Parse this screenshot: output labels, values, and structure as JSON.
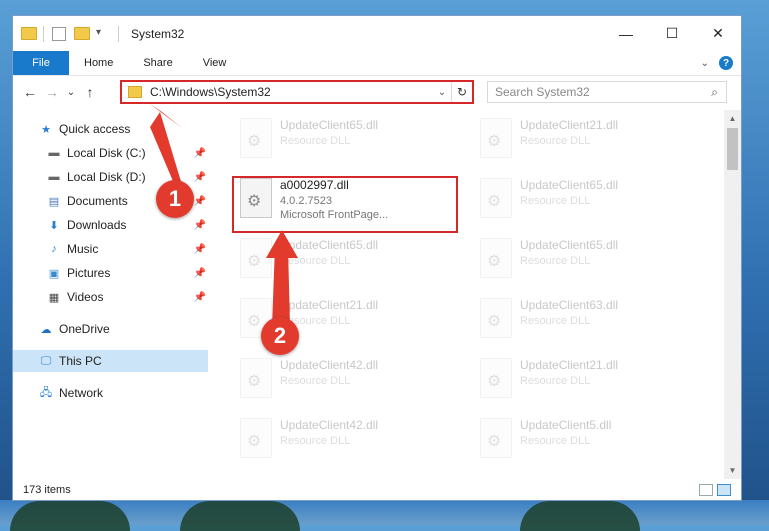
{
  "window": {
    "title": "System32",
    "controls": {
      "minimize": "—",
      "maximize": "☐",
      "close": "✕"
    }
  },
  "ribbon": {
    "file": "File",
    "tabs": [
      "Home",
      "Share",
      "View"
    ],
    "collapse": "⌄",
    "help": "?"
  },
  "address": {
    "path": "C:\\Windows\\System32",
    "search_placeholder": "Search System32"
  },
  "nav": {
    "back": "←",
    "forward": "→",
    "recent": "⌄",
    "up": "↑"
  },
  "sidebar": {
    "items": [
      {
        "label": "Quick access",
        "icon": "star-icon",
        "pinned": false
      },
      {
        "label": "Local Disk (C:)",
        "icon": "drive-icon",
        "pinned": true
      },
      {
        "label": "Local Disk (D:)",
        "icon": "drive-icon",
        "pinned": true
      },
      {
        "label": "Documents",
        "icon": "documents-icon",
        "pinned": true
      },
      {
        "label": "Downloads",
        "icon": "download-icon",
        "pinned": true
      },
      {
        "label": "Music",
        "icon": "music-icon",
        "pinned": true
      },
      {
        "label": "Pictures",
        "icon": "pictures-icon",
        "pinned": true
      },
      {
        "label": "Videos",
        "icon": "videos-icon",
        "pinned": true
      },
      {
        "label": "OneDrive",
        "icon": "cloud-icon",
        "pinned": false
      },
      {
        "label": "This PC",
        "icon": "computer-icon",
        "pinned": false,
        "selected": true
      },
      {
        "label": "Network",
        "icon": "network-icon",
        "pinned": false
      }
    ]
  },
  "files": {
    "highlighted": {
      "name": "a0002997.dll",
      "version": "4.0.2.7523",
      "description": "Microsoft FrontPage..."
    },
    "faded": [
      {
        "name": "UpdateClient65.dll",
        "sub": "Resource DLL"
      },
      {
        "name": "UpdateClient21.dll",
        "sub": "Resource DLL"
      },
      {
        "name": "UpdateClient65.dll",
        "sub": "Resource DLL"
      },
      {
        "name": "UpdateClient65.dll",
        "sub": "Resource DLL"
      },
      {
        "name": "UpdateClient65.dll",
        "sub": "Resource DLL"
      },
      {
        "name": "UpdateClient21.dll",
        "sub": "Resource DLL"
      },
      {
        "name": "UpdateClient63.dll",
        "sub": "Resource DLL"
      },
      {
        "name": "UpdateClient42.dll",
        "sub": "Resource DLL"
      },
      {
        "name": "UpdateClient21.dll",
        "sub": "Resource DLL"
      },
      {
        "name": "UpdateClient42.dll",
        "sub": "Resource DLL"
      },
      {
        "name": "UpdateClient5.dll",
        "sub": "Resource DLL"
      },
      {
        "name": "UpdateClient65.dll",
        "sub": "Resource DLL"
      }
    ]
  },
  "status": {
    "item_count": "173 items"
  },
  "annotations": {
    "step1": "1",
    "step2": "2",
    "color": "#e23b2e"
  },
  "colors": {
    "accent": "#1979ca",
    "highlight_box": "#d62828",
    "selected_nav": "#cce4f7"
  }
}
